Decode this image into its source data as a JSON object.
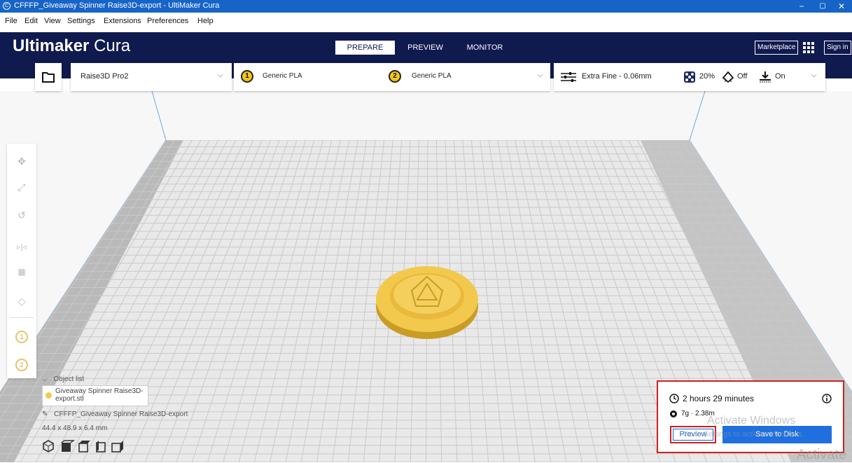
{
  "window": {
    "title": "CFFFP_Giveaway Spinner Raise3D-export - UltiMaker Cura",
    "controls": {
      "minimize": "−",
      "restore": "▢",
      "close": "✕"
    }
  },
  "menu": [
    "File",
    "Edit",
    "View",
    "Settings",
    "Extensions",
    "Preferences",
    "Help"
  ],
  "header": {
    "logo_bold": "Ultimaker",
    "logo_light": "Cura",
    "tabs": [
      "PREPARE",
      "PREVIEW",
      "MONITOR"
    ],
    "active_tab": "PREPARE",
    "marketplace": "Marketplace",
    "signin": "Sign in"
  },
  "toolbar": {
    "printer": "Raise3D Pro2",
    "extruder1": {
      "number": "1",
      "material": "Generic PLA"
    },
    "extruder2": {
      "number": "2",
      "material": "Generic PLA"
    },
    "profile": "Extra Fine - 0.06mm",
    "infill": "20%",
    "support": "Off",
    "adhesion": "On"
  },
  "tools": [
    "move-icon",
    "scale-icon",
    "rotate-icon",
    "mirror-icon",
    "per-model-settings-icon",
    "support-blocker-icon",
    "extruder-1-icon",
    "extruder-2-icon"
  ],
  "extruder_tool_labels": [
    "1",
    "2"
  ],
  "object_list": {
    "header": "Object list",
    "item": "Giveaway Spinner Raise3D-export.stl",
    "project_name": "CFFFP_Giveaway Spinner Raise3D-export",
    "dimensions": "44.4 x 48.9 x 6.4 mm"
  },
  "print_info": {
    "time": "2 hours 29 minutes",
    "material": "7g · 2.38m",
    "preview_button": "Preview",
    "save_button": "Save to Disk"
  },
  "watermark": {
    "line1": "Activate Windows",
    "line2": "Go to Settings to activate Windows.",
    "corner": "Activate"
  },
  "colors": {
    "header_bg": "#0f1a4e",
    "titlebar_bg": "#1764c8",
    "accent": "#1f6fe0",
    "highlight": "#d02020",
    "model": "#f2c94c"
  }
}
